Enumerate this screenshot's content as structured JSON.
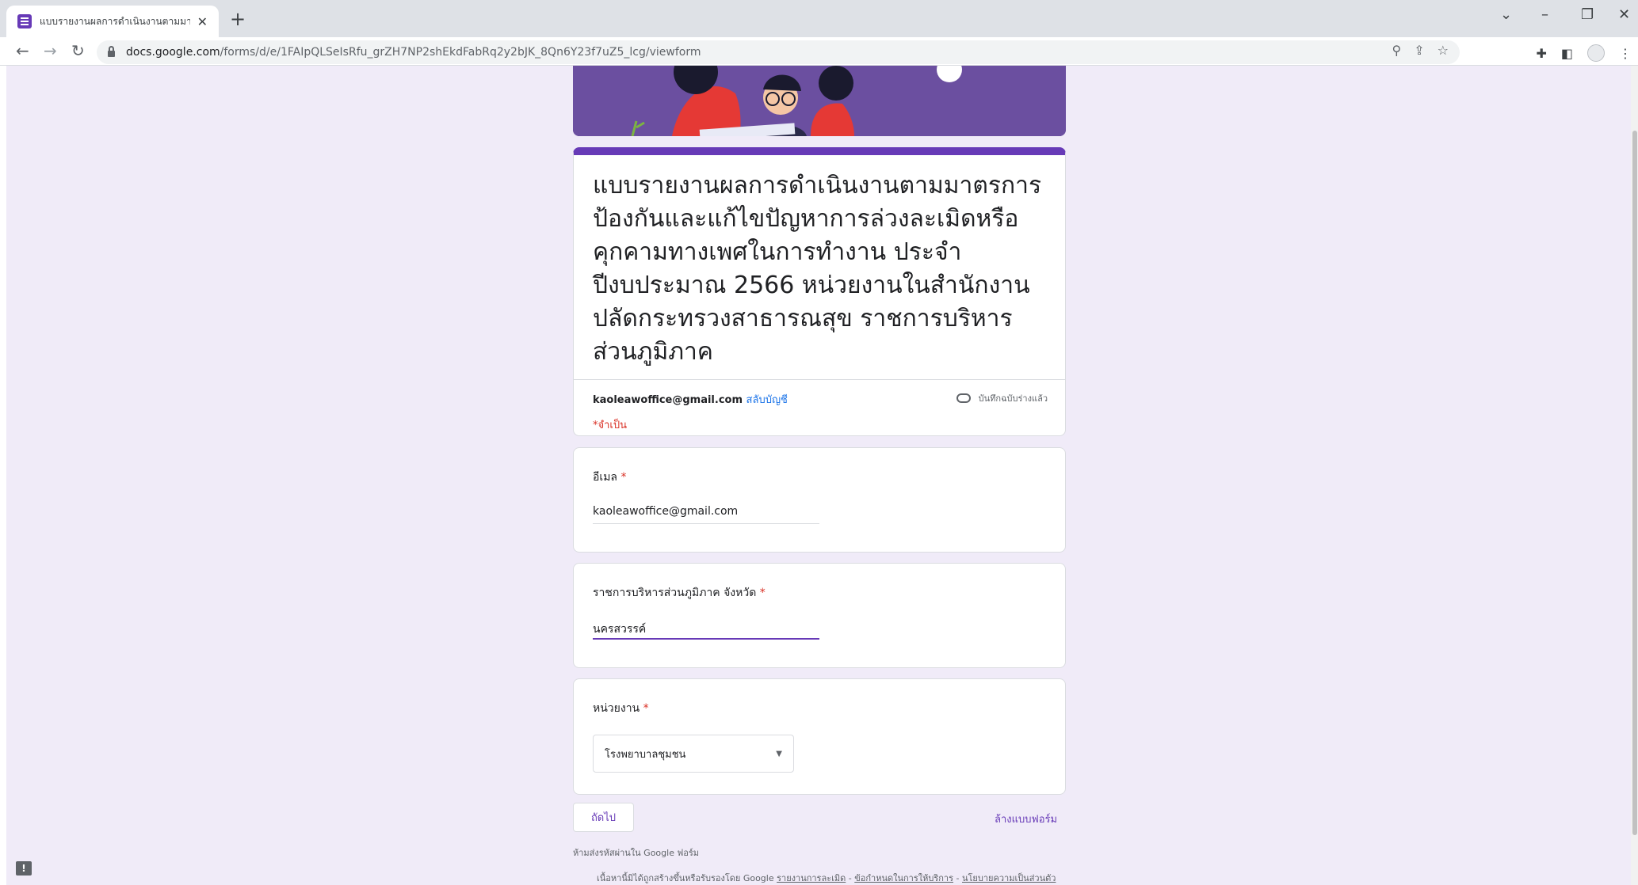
{
  "browser": {
    "tab_title": "แบบรายงานผลการดำเนินงานตามมาตรการ",
    "url_domain": "docs.google.com",
    "url_path": "/forms/d/e/1FAIpQLSeIsRfu_grZH7NP2shEkdFabRq2y2bJK_8Qn6Y23f7uZ5_lcg/viewform"
  },
  "form": {
    "title": "แบบรายงานผลการดำเนินงานตามมาตรการป้องกันและแก้ไขปัญหาการล่วงละเมิดหรือคุกคามทางเพศในการทำงาน ประจำปีงบประมาณ 2566 หน่วยงานในสำนักงานปลัดกระทรวงสาธารณสุข  ราชการบริหารส่วนภูมิภาค",
    "account_email": "kaoleawoffice@gmail.com",
    "switch_account": "สลับบัญชี",
    "draft_saved": "บันทึกฉบับร่างแล้ว",
    "required_note": "*จำเป็น",
    "questions": [
      {
        "label": "อีเมล",
        "required": "*",
        "value": "kaoleawoffice@gmail.com"
      },
      {
        "label": "ราชการบริหารส่วนภูมิภาค จังหวัด",
        "required": "*",
        "value": "นครสวรรค์"
      },
      {
        "label": "หน่วยงาน",
        "required": "*",
        "value": "โรงพยาบาลชุมชน"
      }
    ],
    "next_button": "ถัดไป",
    "clear_form": "ล้างแบบฟอร์ม",
    "footer_warning": "ห้ามส่งรหัสผ่านใน Google ฟอร์ม",
    "footer_disclaimer": "เนื้อหานี้มิได้ถูกสร้างขึ้นหรือรับรองโดย Google",
    "footer_links": [
      "รายงานการละเมิด",
      "ข้อกำหนดในการให้บริการ",
      "นโยบายความเป็นส่วนตัว"
    ]
  },
  "colors": {
    "accent": "#673ab7",
    "background": "#f0ebf8",
    "required": "#d93025"
  }
}
